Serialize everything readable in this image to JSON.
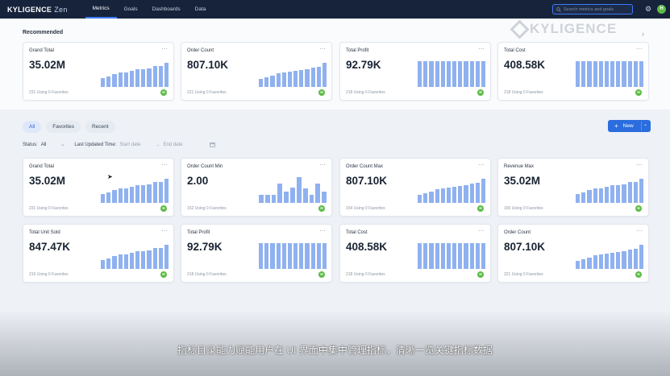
{
  "header": {
    "brand": "KYLIGENCE",
    "product": "Zen",
    "nav": [
      "Metrics",
      "Goals",
      "Dashboards",
      "Data"
    ],
    "active_nav": "Metrics",
    "search_placeholder": "Search metrics and goals",
    "avatar_initial": "H"
  },
  "watermark": "KYLIGENCE",
  "recommended": {
    "title": "Recommended",
    "cards": [
      {
        "title": "Grand Total",
        "value": "35.02M",
        "footer": "231 Using 0 Favorites",
        "bars": [
          0.35,
          0.42,
          0.5,
          0.55,
          0.55,
          0.62,
          0.68,
          0.68,
          0.72,
          0.8,
          0.8,
          0.95
        ]
      },
      {
        "title": "Order Count",
        "value": "807.10K",
        "footer": "221 Using 0 Favorites",
        "bars": [
          0.3,
          0.38,
          0.45,
          0.52,
          0.55,
          0.6,
          0.62,
          0.66,
          0.7,
          0.74,
          0.78,
          0.95
        ]
      },
      {
        "title": "Total Profit",
        "value": "92.79K",
        "footer": "218 Using 0 Favorites",
        "bars": [
          1,
          1,
          1,
          1,
          1,
          1,
          1,
          1,
          1,
          1,
          1,
          1
        ]
      },
      {
        "title": "Total Cost",
        "value": "408.58K",
        "footer": "218 Using 0 Favorites",
        "bars": [
          1,
          1,
          1,
          1,
          1,
          1,
          1,
          1,
          1,
          1,
          1,
          1
        ]
      }
    ]
  },
  "tabs": [
    "All",
    "Favorites",
    "Recent"
  ],
  "active_tab": "All",
  "new_button": "New",
  "filters": {
    "status_label": "Status:",
    "status_value": "All",
    "updated_label": "Last Updated Time:",
    "start_placeholder": "Start date",
    "arrow": "→",
    "end_placeholder": "End date"
  },
  "metrics": {
    "cards": [
      {
        "title": "Grand Total",
        "value": "35.02M",
        "footer": "231 Using 0 Favorites",
        "bars": [
          0.35,
          0.42,
          0.5,
          0.55,
          0.55,
          0.62,
          0.68,
          0.68,
          0.72,
          0.8,
          0.8,
          0.95
        ]
      },
      {
        "title": "Order Count Min",
        "value": "2.00",
        "footer": "152 Using 0 Favorites",
        "bars": [
          0.3,
          0.3,
          0.3,
          0.75,
          0.45,
          0.6,
          1,
          0.55,
          0.3,
          0.75,
          0.45
        ]
      },
      {
        "title": "Order Count Max",
        "value": "807.10K",
        "footer": "154 Using 0 Favorites",
        "bars": [
          0.3,
          0.38,
          0.45,
          0.52,
          0.55,
          0.6,
          0.62,
          0.66,
          0.7,
          0.74,
          0.78,
          0.95
        ]
      },
      {
        "title": "Revenue Max",
        "value": "35.02M",
        "footer": "165 Using 0 Favorites",
        "bars": [
          0.35,
          0.42,
          0.5,
          0.55,
          0.55,
          0.62,
          0.68,
          0.68,
          0.72,
          0.8,
          0.8,
          0.95
        ]
      },
      {
        "title": "Total Unit Sold",
        "value": "847.47K",
        "footer": "216 Using 0 Favorites",
        "bars": [
          0.35,
          0.42,
          0.5,
          0.55,
          0.55,
          0.62,
          0.68,
          0.68,
          0.72,
          0.8,
          0.8,
          0.95
        ]
      },
      {
        "title": "Total Profit",
        "value": "92.79K",
        "footer": "218 Using 0 Favorites",
        "bars": [
          1,
          1,
          1,
          1,
          1,
          1,
          1,
          1,
          1,
          1,
          1,
          1
        ]
      },
      {
        "title": "Total Cost",
        "value": "408.58K",
        "footer": "218 Using 0 Favorites",
        "bars": [
          1,
          1,
          1,
          1,
          1,
          1,
          1,
          1,
          1,
          1,
          1,
          1
        ]
      },
      {
        "title": "Order Count",
        "value": "807.10K",
        "footer": "221 Using 0 Favorites",
        "bars": [
          0.3,
          0.38,
          0.45,
          0.52,
          0.55,
          0.6,
          0.62,
          0.66,
          0.7,
          0.74,
          0.78,
          0.95
        ]
      }
    ]
  },
  "subtitle": "指标目录能力赋能用户在 UI 界面中集中管理指标，清晰一览关键指标数据",
  "colors": {
    "accent": "#2b6ddf",
    "bar": "#8fb1ef",
    "topbar": "#16233b",
    "favorite": "#5dbb46"
  }
}
